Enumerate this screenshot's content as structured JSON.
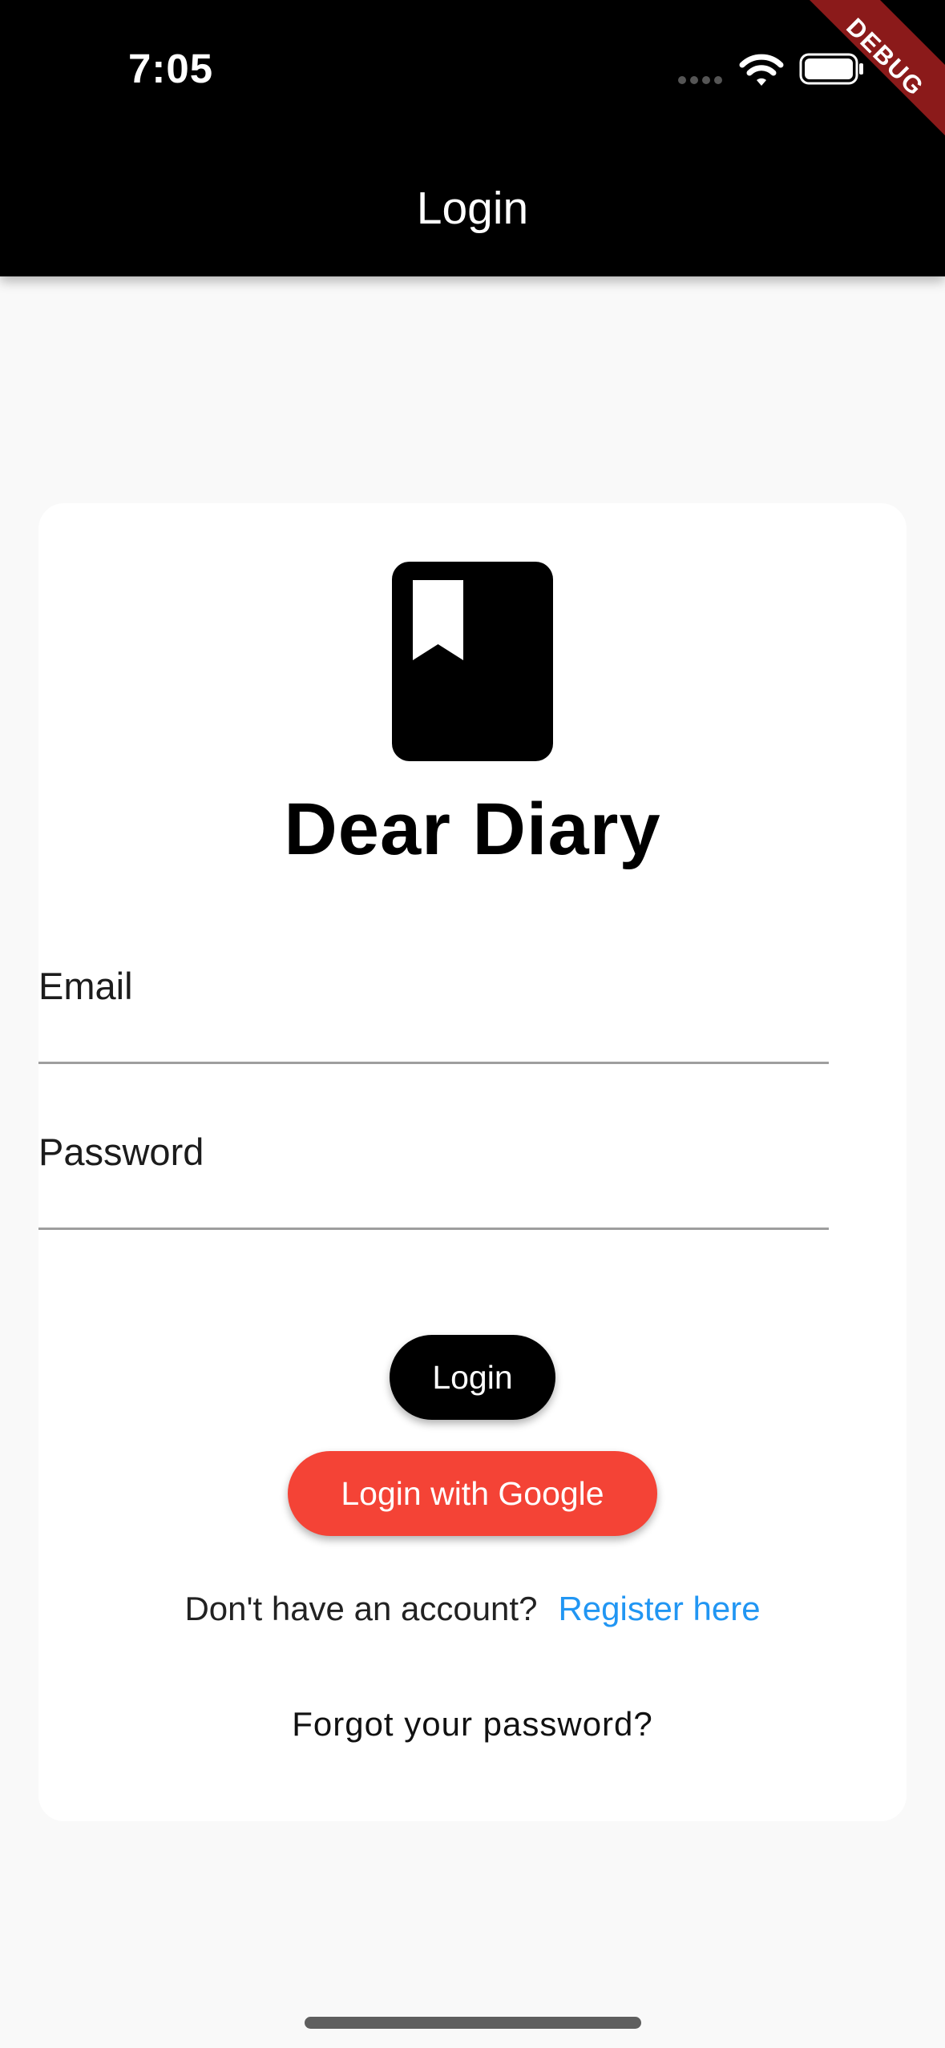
{
  "status_bar": {
    "time": "7:05",
    "signal_icon": "signal-dots-icon",
    "wifi_icon": "wifi-icon",
    "battery_icon": "battery-icon"
  },
  "debug_banner": {
    "label": "DEBUG",
    "color": "#8b1a1a"
  },
  "app_bar": {
    "title": "Login",
    "background": "#000000"
  },
  "login_card": {
    "logo_icon": "bookmark-book-icon",
    "app_name": "Dear Diary",
    "email_field": {
      "label": "Email",
      "value": ""
    },
    "password_field": {
      "label": "Password",
      "value": ""
    },
    "login_button": {
      "label": "Login",
      "color": "#000000"
    },
    "google_button": {
      "label": "Login with Google",
      "color": "#f44336"
    },
    "register": {
      "prompt": "Don't have an account?",
      "link": "Register here",
      "link_color": "#2196f3"
    },
    "forgot_password": "Forgot your password?"
  }
}
